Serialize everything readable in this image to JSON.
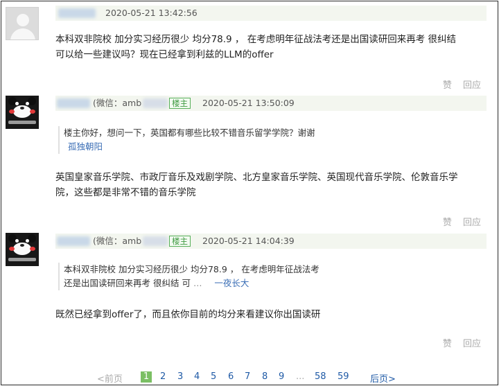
{
  "comments": [
    {
      "timestamp": "2020-05-21 13:42:56",
      "text_line1": "本科双非院校 加分实习经历很少 均分78.9 ， 在考虑明年征战法考还是出国读研回来再考 很纠结",
      "text_line2": "可以给一些建议吗？现在已经拿到利兹的LLM的offer",
      "like_label": "赞",
      "reply_label": "回应"
    },
    {
      "wechat_label": "(微信：amb",
      "owner_badge": "楼主",
      "timestamp": "2020-05-21 13:50:09",
      "quote_text": "楼主你好，想问一下，英国都有哪些比较不错音乐留学学院？谢谢",
      "quote_author": "孤独朝阳",
      "text_line1": "英国皇家音乐学院、市政厅音乐及戏剧学院、北方皇家音乐学院、英国现代音乐学院、伦敦音乐学",
      "text_line2": "院，这些都是非常不错的音乐学院",
      "like_label": "赞",
      "reply_label": "回应"
    },
    {
      "wechat_label": "(微信：amb",
      "owner_badge": "楼主",
      "timestamp": "2020-05-21 14:04:39",
      "quote_line1": "本科双非院校 加分实习经历很少 均分78.9 ， 在考虑明年征战法考",
      "quote_line2": "还是出国读研回来再考 很纠结 可",
      "quote_ellipsis": "…",
      "quote_author": "一夜长大",
      "text_line1": "既然已经拿到offer了，而且依你目前的均分来看建议你出国读研",
      "like_label": "赞",
      "reply_label": "回应"
    }
  ],
  "pagination": {
    "prev": "<前页",
    "current": "1",
    "pages": [
      "2",
      "3",
      "4",
      "5",
      "6",
      "7",
      "8",
      "9"
    ],
    "ellipsis": "...",
    "tail_pages": [
      "58",
      "59"
    ],
    "next": "后页>"
  },
  "colors": {
    "meta_bar": "#f3f6ef",
    "link": "#1f5aa6",
    "badge_green": "#58b05a",
    "current_page": "#7bbf64"
  }
}
